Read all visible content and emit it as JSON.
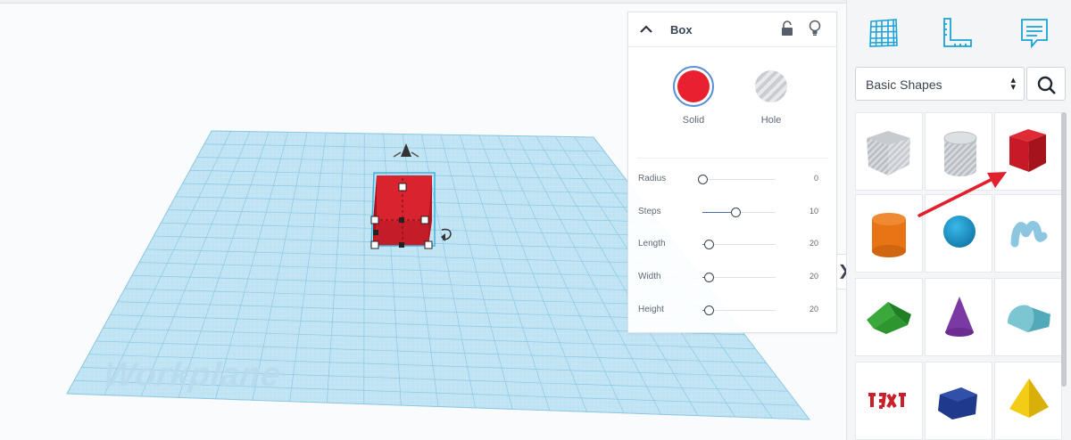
{
  "canvas": {
    "workplane_label": "Workplane"
  },
  "inspector": {
    "title": "Box",
    "modes": [
      {
        "label": "Solid",
        "selected": true,
        "color": "#e8202f"
      },
      {
        "label": "Hole",
        "selected": false
      }
    ],
    "params": [
      {
        "label": "Radius",
        "value": "0",
        "fraction": 0.0
      },
      {
        "label": "Steps",
        "value": "10",
        "fraction": 0.45
      },
      {
        "label": "Length",
        "value": "20",
        "fraction": 0.08
      },
      {
        "label": "Width",
        "value": "20",
        "fraction": 0.08
      },
      {
        "label": "Height",
        "value": "20",
        "fraction": 0.08
      }
    ]
  },
  "sidebar": {
    "tools": [
      "grid-icon",
      "ruler-icon",
      "notes-icon"
    ],
    "shape_library": {
      "selected": "Basic Shapes"
    },
    "shapes": [
      {
        "name": "box-hole"
      },
      {
        "name": "cylinder-hole"
      },
      {
        "name": "box"
      },
      {
        "name": "cylinder"
      },
      {
        "name": "sphere"
      },
      {
        "name": "scribble"
      },
      {
        "name": "roof"
      },
      {
        "name": "cone"
      },
      {
        "name": "round-roof"
      },
      {
        "name": "text"
      },
      {
        "name": "polygon"
      },
      {
        "name": "pyramid"
      }
    ]
  },
  "colors": {
    "accent": "#4a6fa5",
    "solid_red": "#e8202f",
    "workplane": "#a9d8ef",
    "annotation_arrow": "#e0212d"
  }
}
